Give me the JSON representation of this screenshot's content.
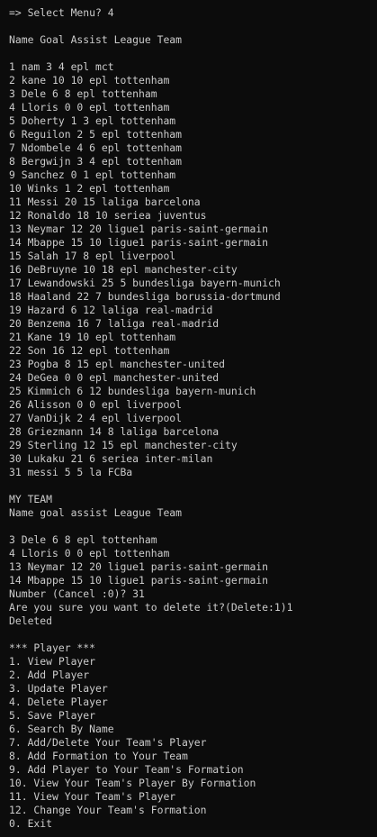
{
  "prompt_line": "=> Select Menu? 4",
  "list_header": "Name Goal Assist League Team",
  "players": [
    "1 nam 3 4 epl mct",
    "2 kane 10 10 epl tottenham",
    "3 Dele 6 8 epl tottenham",
    "4 Lloris 0 0 epl tottenham",
    "5 Doherty 1 3 epl tottenham",
    "6 Reguilon 2 5 epl tottenham",
    "7 Ndombele 4 6 epl tottenham",
    "8 Bergwijn 3 4 epl tottenham",
    "9 Sanchez 0 1 epl tottenham",
    "10 Winks 1 2 epl tottenham",
    "11 Messi 20 15 laliga barcelona",
    "12 Ronaldo 18 10 seriea juventus",
    "13 Neymar 12 20 ligue1 paris-saint-germain",
    "14 Mbappe 15 10 ligue1 paris-saint-germain",
    "15 Salah 17 8 epl liverpool",
    "16 DeBruyne 10 18 epl manchester-city",
    "17 Lewandowski 25 5 bundesliga bayern-munich",
    "18 Haaland 22 7 bundesliga borussia-dortmund",
    "19 Hazard 6 12 laliga real-madrid",
    "20 Benzema 16 7 laliga real-madrid",
    "21 Kane 19 10 epl tottenham",
    "22 Son 16 12 epl tottenham",
    "23 Pogba 8 15 epl manchester-united",
    "24 DeGea 0 0 epl manchester-united",
    "25 Kimmich 6 12 bundesliga bayern-munich",
    "26 Alisson 0 0 epl liverpool",
    "27 VanDijk 2 4 epl liverpool",
    "28 Griezmann 14 8 laliga barcelona",
    "29 Sterling 12 15 epl manchester-city",
    "30 Lukaku 21 6 seriea inter-milan",
    "31 messi 5 5 la FCBa"
  ],
  "my_team_title": "MY TEAM",
  "my_team_header": "Name goal assist League Team",
  "my_team": [
    "3 Dele 6 8 epl tottenham",
    "4 Lloris 0 0 epl tottenham",
    "13 Neymar 12 20 ligue1 paris-saint-germain",
    "14 Mbappe 15 10 ligue1 paris-saint-germain"
  ],
  "number_prompt": "Number (Cancel :0)? 31",
  "confirm_prompt": "Are you sure you want to delete it?(Delete:1)1",
  "result": "Deleted",
  "menu_title": "*** Player ***",
  "menu": [
    "1. View Player",
    "2. Add Player",
    "3. Update Player",
    "4. Delete Player",
    "5. Save Player",
    "6. Search By Name",
    "7. Add/Delete Your Team's Player",
    "8. Add Formation to Your Team",
    "9. Add Player to Your Team's Formation",
    "10. View Your Team's Player By Formation",
    "11. View Your Team's Player",
    "12. Change Your Team's Formation",
    "0. Exit"
  ]
}
